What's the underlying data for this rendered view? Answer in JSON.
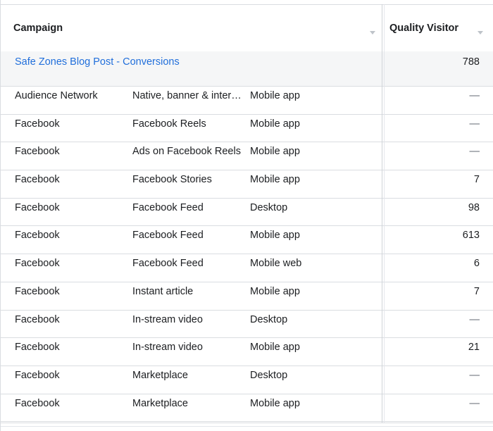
{
  "header": {
    "campaign_label": "Campaign",
    "quality_label": "Quality Visitor"
  },
  "summary": {
    "campaign_name": "Safe Zones Blog Post - Conversions",
    "quality_value": "788"
  },
  "rows": [
    {
      "platform": "Audience Network",
      "placement": "Native, banner & interstitial",
      "device": "Mobile app",
      "value": "—"
    },
    {
      "platform": "Facebook",
      "placement": "Facebook Reels",
      "device": "Mobile app",
      "value": "—"
    },
    {
      "platform": "Facebook",
      "placement": "Ads on Facebook Reels",
      "device": "Mobile app",
      "value": "—"
    },
    {
      "platform": "Facebook",
      "placement": "Facebook Stories",
      "device": "Mobile app",
      "value": "7"
    },
    {
      "platform": "Facebook",
      "placement": "Facebook Feed",
      "device": "Desktop",
      "value": "98"
    },
    {
      "platform": "Facebook",
      "placement": "Facebook Feed",
      "device": "Mobile app",
      "value": "613"
    },
    {
      "platform": "Facebook",
      "placement": "Facebook Feed",
      "device": "Mobile web",
      "value": "6"
    },
    {
      "platform": "Facebook",
      "placement": "Instant article",
      "device": "Mobile app",
      "value": "7"
    },
    {
      "platform": "Facebook",
      "placement": "In-stream video",
      "device": "Desktop",
      "value": "—"
    },
    {
      "platform": "Facebook",
      "placement": "In-stream video",
      "device": "Mobile app",
      "value": "21"
    },
    {
      "platform": "Facebook",
      "placement": "Marketplace",
      "device": "Desktop",
      "value": "—"
    },
    {
      "platform": "Facebook",
      "placement": "Marketplace",
      "device": "Mobile app",
      "value": "—"
    }
  ]
}
